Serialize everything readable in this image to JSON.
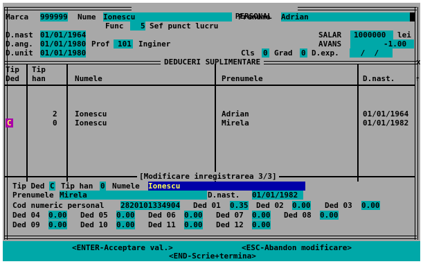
{
  "title": {
    "left": ">>>",
    "center": "ACTUALIZARE  PERSONAL",
    "right": "<<<"
  },
  "header": {
    "marca_label": "Marca",
    "marca_value": "999999",
    "nume_label": "Nume",
    "nume_value": "Ionescu",
    "prenume_label": "Prenume",
    "prenume_value": "Adrian",
    "func_label": "Func",
    "func_code": "5",
    "func_value": "Sef punct lucru",
    "dnast_label": "D.nast",
    "dnast_value": "01/01/1964",
    "salar_label": "SALAR",
    "salar_value": "1000000",
    "salar_unit": "lei",
    "dang_label": "D.ang.",
    "dang_value": "01/01/1980",
    "prof_label": "Prof",
    "prof_code": "101",
    "prof_value": "Inginer",
    "avans_label": "AVANS",
    "avans_value": "-1.00",
    "dunit_label": "D.unit",
    "dunit_value": "01/01/1980",
    "cls_label": "Cls",
    "cls_value": "0",
    "grad_label": "Grad",
    "grad_value": "0",
    "dexp_label": "D.exp.",
    "dexp_value": " /  / "
  },
  "deduceri": {
    "title": "DEDUCERI SUPLIMENTARE",
    "columns": {
      "tip_ded": "Tip\nDed",
      "tip_han": "Tip\nhan",
      "numele": "Numele",
      "prenumele": "Prenumele",
      "dnast": "D.nast."
    },
    "rows": [
      {
        "tip_ded": "",
        "tip_han": "2",
        "numele": "Ionescu",
        "prenumele": "Adrian",
        "dnast": "01/01/1964"
      },
      {
        "tip_ded": "C",
        "tip_han": "0",
        "numele": "Ionescu",
        "prenumele": "Mirela",
        "dnast": "01/01/1982"
      }
    ],
    "close_marker": "x",
    "scroll_marker": "↑"
  },
  "editor": {
    "title": "[Modificare inregistrarea 3/3]",
    "tip_ded_label": "Tip Ded",
    "tip_ded_value": "C",
    "tip_han_label": "Tip han",
    "tip_han_value": "0",
    "numele_label": "Numele",
    "numele_value": "Ionescu",
    "prenumele_label": "Prenumele",
    "prenumele_value": "Mirela",
    "dnast_label": "D.nast.",
    "dnast_value": "01/01/1982",
    "cnp_label": "Cod numeric personal",
    "cnp_value": "2820101334904",
    "ded": [
      {
        "label": "Ded 01",
        "value": "0.35"
      },
      {
        "label": "Ded 02",
        "value": "0.00"
      },
      {
        "label": "Ded 03",
        "value": "0.00"
      },
      {
        "label": "Ded 04",
        "value": "0.00"
      },
      {
        "label": "Ded 05",
        "value": "0.00"
      },
      {
        "label": "Ded 06",
        "value": "0.00"
      },
      {
        "label": "Ded 07",
        "value": "0.00"
      },
      {
        "label": "Ded 08",
        "value": "0.00"
      },
      {
        "label": "Ded 09",
        "value": "0.00"
      },
      {
        "label": "Ded 10",
        "value": "0.00"
      },
      {
        "label": "Ded 11",
        "value": "0.00"
      },
      {
        "label": "Ded 12",
        "value": "0.00"
      }
    ]
  },
  "status": {
    "enter": "<ENTER-Acceptare val.>",
    "esc": "<ESC-Abandon modificare>",
    "end": "<END-Scrie+termina>"
  }
}
